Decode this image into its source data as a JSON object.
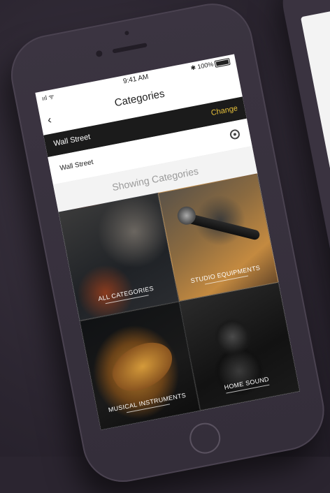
{
  "status_bar": {
    "signal": "ııl ᯤ",
    "time": "9:41 AM",
    "battery_text": "✱ 100%"
  },
  "nav": {
    "back_glyph": "‹",
    "title": "Categories"
  },
  "location": {
    "label": "Wall Street",
    "change_label": "Change"
  },
  "search": {
    "value": "Wall Street",
    "locate_icon": "crosshair-icon"
  },
  "section": {
    "heading": "Showing Categories"
  },
  "categories": [
    {
      "label": "ALL CATEGORIES"
    },
    {
      "label": "STUDIO EQUIPMENTS"
    },
    {
      "label": "MUSICAL INSTRUMENTS"
    },
    {
      "label": "HOME SOUND"
    }
  ],
  "colors": {
    "accent": "#e8c23a",
    "location_bar": "#1b1b1b",
    "background": "#2b2530"
  }
}
